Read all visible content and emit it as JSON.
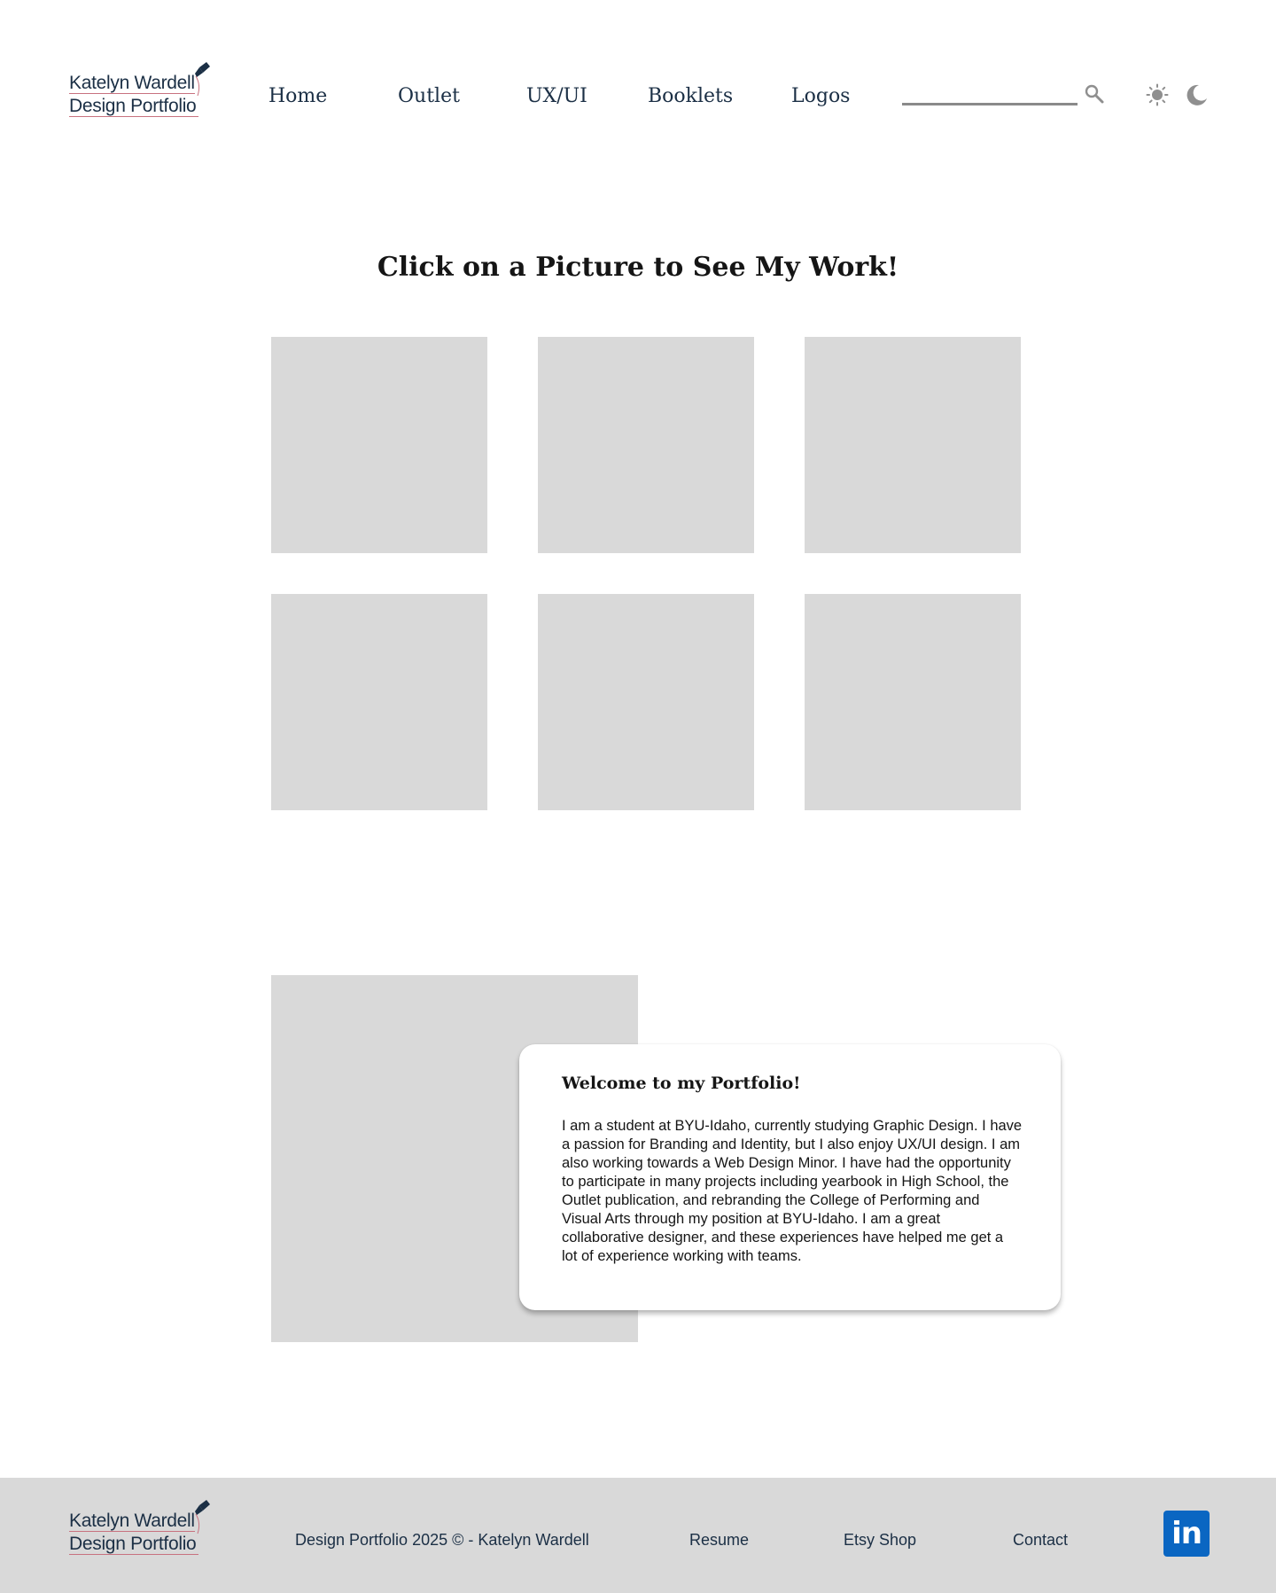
{
  "header": {
    "logo": {
      "line1": "Katelyn Wardell",
      "line2": "Design Portfolio"
    },
    "nav": [
      {
        "label": "Home"
      },
      {
        "label": "Outlet"
      },
      {
        "label": "UX/UI"
      },
      {
        "label": "Booklets"
      },
      {
        "label": "Logos"
      }
    ],
    "icons": {
      "search": "search-icon",
      "light_mode": "sun-icon",
      "dark_mode": "moon-icon"
    }
  },
  "gallery": {
    "title": "Click on a Picture to See My Work!"
  },
  "about": {
    "heading": "Welcome to my Portfolio!",
    "body": "I am a student at BYU-Idaho, currently studying Graphic Design. I have a passion for Branding and Identity, but I also enjoy UX/UI design. I am also working towards a Web Design Minor. I have had the opportunity to participate in many projects including yearbook in High School, the Outlet publication, and rebranding the College of Performing and Visual Arts through my position at BYU-Idaho. I am a great collaborative designer, and these experiences have helped me get a lot of experience working with teams."
  },
  "footer": {
    "logo": {
      "line1": "Katelyn Wardell",
      "line2": "Design Portfolio"
    },
    "copyright": "Design Portfolio 2025 © - Katelyn Wardell",
    "links": [
      {
        "label": "Resume"
      },
      {
        "label": "Etsy Shop"
      },
      {
        "label": "Contact"
      }
    ],
    "social": {
      "label": "in",
      "icon": "linkedin-icon"
    }
  },
  "colors": {
    "text_navy": "#1b2f45",
    "placeholder_gray": "#d9d9d9",
    "linkedin_blue": "#0a66c2",
    "logo_accent": "#c8727f"
  }
}
